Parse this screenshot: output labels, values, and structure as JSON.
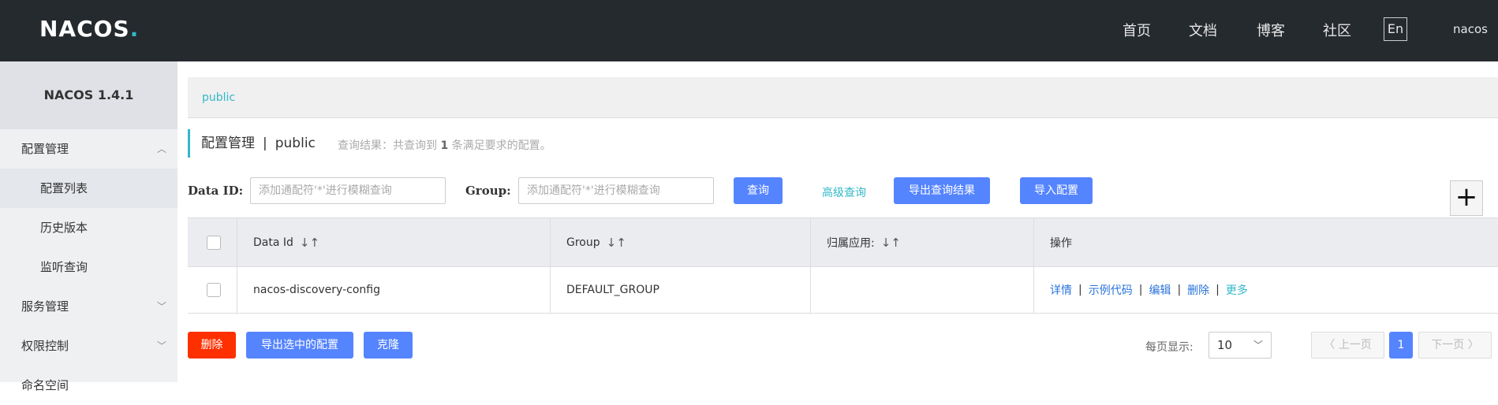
{
  "header": {
    "logo_text": "NACOS",
    "logo_dot": ".",
    "nav": [
      "首页",
      "文档",
      "博客",
      "社区"
    ],
    "lang_button": "En",
    "user": "nacos"
  },
  "sidebar": {
    "version": "NACOS 1.4.1",
    "groups": [
      {
        "label": "配置管理",
        "expanded": true
      },
      {
        "label": "服务管理",
        "expanded": false
      },
      {
        "label": "权限控制",
        "expanded": false
      },
      {
        "label": "命名空间",
        "expanded": false
      }
    ],
    "sub_items": [
      "配置列表",
      "历史版本",
      "监听查询"
    ]
  },
  "namespace_bar": {
    "active": "public"
  },
  "title": {
    "main": "配置管理",
    "sep": "|",
    "namespace": "public",
    "hint_prefix": "查询结果：共查询到",
    "hint_count": "1",
    "hint_suffix": "条满足要求的配置。"
  },
  "search": {
    "data_id_label": "Data ID:",
    "data_id_placeholder": "添加通配符'*'进行模糊查询",
    "group_label": "Group:",
    "group_placeholder": "添加通配符'*'进行模糊查询",
    "query_button": "查询",
    "advanced_link": "高级查询",
    "export_button": "导出查询结果",
    "import_button": "导入配置",
    "add_button": "+"
  },
  "table": {
    "columns": [
      "Data Id",
      "Group",
      "归属应用:",
      "操作"
    ],
    "sort_icon": "↓↑",
    "rows": [
      {
        "data_id": "nacos-discovery-config",
        "group": "DEFAULT_GROUP",
        "app": "",
        "ops": [
          "详情",
          "示例代码",
          "编辑",
          "删除"
        ],
        "more": "更多"
      }
    ],
    "op_sep": "|"
  },
  "footer": {
    "delete_button": "删除",
    "export_selected_button": "导出选中的配置",
    "clone_button": "克隆",
    "page_size_label": "每页显示:",
    "page_size_value": "10",
    "prev_button": "上一页",
    "current_page": "1",
    "next_button": "下一页"
  },
  "colors": {
    "accent": "#32b8c7",
    "primary": "#5584ff",
    "danger": "#ff3000",
    "header_bg": "#252a2f"
  }
}
